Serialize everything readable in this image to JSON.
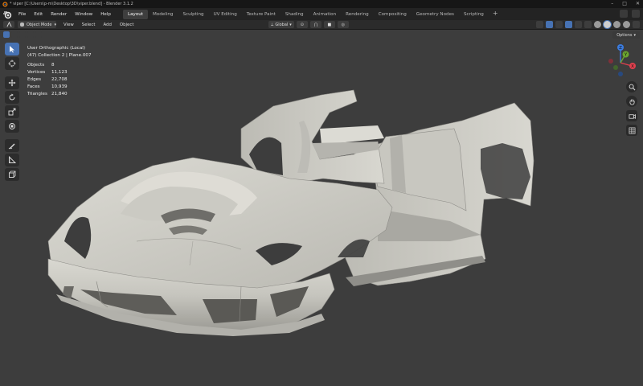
{
  "window": {
    "title": "* viper [C:\\Users\\p-m\\Desktop\\3D\\viper.blend] - Blender 3.1.2",
    "controls": {
      "minimize": "–",
      "maximize": "□",
      "close": "✕"
    }
  },
  "menubar": {
    "menus": [
      "File",
      "Edit",
      "Render",
      "Window",
      "Help"
    ],
    "workspaces": [
      "Layout",
      "Modeling",
      "Sculpting",
      "UV Editing",
      "Texture Paint",
      "Shading",
      "Animation",
      "Rendering",
      "Compositing",
      "Geometry Nodes",
      "Scripting"
    ],
    "active_workspace": "Layout",
    "add_tab": "+"
  },
  "header": {
    "mode": "Object Mode",
    "menus": [
      "View",
      "Select",
      "Add",
      "Object"
    ],
    "transform_orientation": "Global"
  },
  "viewport": {
    "options_label": "Options",
    "view_name": "User Orthographic (Local)",
    "collection_info": "(47) Collection 2 | Plane.007",
    "stats": [
      {
        "label": "Objects",
        "value": "8"
      },
      {
        "label": "Vertices",
        "value": "11,123"
      },
      {
        "label": "Edges",
        "value": "22,708"
      },
      {
        "label": "Faces",
        "value": "10,939"
      },
      {
        "label": "Triangles",
        "value": "21,840"
      }
    ],
    "gizmo_axes": {
      "x": "X",
      "y": "Y",
      "z": "Z"
    }
  },
  "colors": {
    "accent": "#4772b3",
    "viewport_bg": "#3d3d3d",
    "axis_x": "#e0404e",
    "axis_y": "#6ba52e",
    "axis_z": "#3b7ce0"
  },
  "icons": {
    "tools": [
      "cursor-select-icon",
      "cursor-3d-icon",
      "move-icon",
      "rotate-icon",
      "scale-icon",
      "transform-icon",
      "annotate-icon",
      "measure-icon",
      "add-cube-icon"
    ],
    "navigation": [
      "zoom-icon",
      "pan-hand-icon",
      "camera-icon",
      "grid-icon"
    ]
  }
}
